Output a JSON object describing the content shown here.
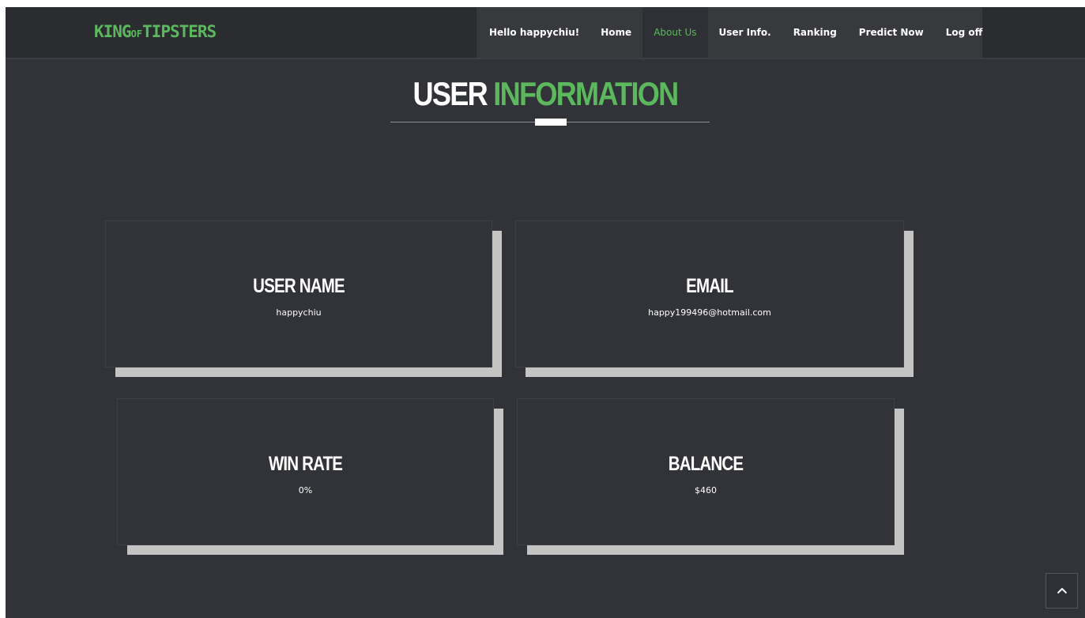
{
  "brand": {
    "logo_part1": "KING",
    "logo_part2": "OF",
    "logo_part3": "TIPSTERS"
  },
  "nav": {
    "greeting": "Hello happychiu!",
    "items": [
      {
        "label": "Home"
      },
      {
        "label": "About Us"
      },
      {
        "label": "User Info."
      },
      {
        "label": "Ranking"
      },
      {
        "label": "Predict Now"
      },
      {
        "label": "Log off"
      }
    ]
  },
  "page": {
    "title_white": "USER",
    "title_green": "INFORMATION"
  },
  "cards": {
    "username": {
      "label": "USER NAME",
      "value": "happychiu"
    },
    "email": {
      "label": "EMAIL",
      "value": "happy199496@hotmail.com"
    },
    "winrate": {
      "label": "WIN RATE",
      "value": "0%"
    },
    "balance": {
      "label": "BALANCE",
      "value": "$460"
    }
  },
  "icons": {
    "back_to_top": "chevron-up-icon"
  },
  "colors": {
    "accent": "#5cb85c",
    "background": "#323338",
    "navbar": "#2b2c30",
    "card_shadow": "#c4c4c4"
  }
}
